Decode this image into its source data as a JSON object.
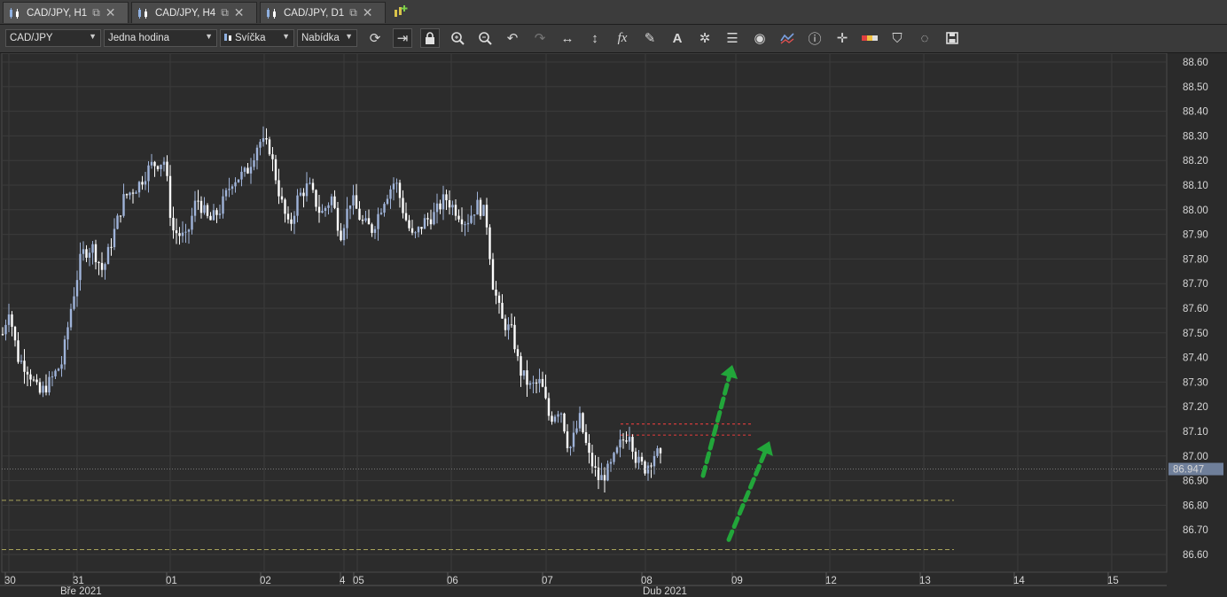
{
  "tabs": [
    {
      "label": "CAD/JPY, H1",
      "active": true
    },
    {
      "label": "CAD/JPY, H4",
      "active": false
    },
    {
      "label": "CAD/JPY, D1",
      "active": false
    }
  ],
  "toolbar": {
    "instrument": "CAD/JPY",
    "timeframe": "Jedna hodina",
    "chart_type": "Svíčka",
    "price_side": "Nabídka",
    "icons": [
      "refresh-icon",
      "shift-chart-icon",
      "lock-icon",
      "zoom-in-icon",
      "zoom-out-icon",
      "undo-icon",
      "redo-icon",
      "horizontal-resize-icon",
      "vertical-resize-icon",
      "indicator-fx-icon",
      "pencil-icon",
      "text-tool-icon",
      "crosshair-star-icon",
      "layers-icon",
      "eye-icon",
      "chart-pattern-icon",
      "info-icon",
      "cursor-cross-icon",
      "ruler-icon",
      "paint-bucket-icon",
      "cycle-icon",
      "save-icon"
    ]
  },
  "colors": {
    "background": "#2a2a2a",
    "bull": "#9fb3d9",
    "bear": "#ffffff",
    "grid": "#3b3b3b",
    "price_tag": "#6f7f9a",
    "red_lines": "#d23b3b",
    "yellow_lines": "#a8a35a",
    "arrows": "#22a63a"
  },
  "chart_data": {
    "type": "candlestick",
    "instrument": "CAD/JPY",
    "timeframe": "H1",
    "ylim": [
      86.55,
      88.65
    ],
    "y_ticks": [
      "88.60",
      "88.50",
      "88.40",
      "88.30",
      "88.20",
      "88.10",
      "88.00",
      "87.90",
      "87.80",
      "87.70",
      "87.60",
      "87.50",
      "87.40",
      "87.30",
      "87.20",
      "87.10",
      "87.00",
      "86.90",
      "86.80",
      "86.70",
      "86.60"
    ],
    "x_ticks": [
      "30",
      "31",
      "01",
      "02",
      "4",
      "05",
      "06",
      "07",
      "08",
      "09",
      "12",
      "13",
      "14",
      "15"
    ],
    "x_month_labels": [
      "Bře 2021",
      "Dub 2021"
    ],
    "current_price": "86.947",
    "horizontal_levels": {
      "red_dotted": [
        87.13,
        87.085
      ],
      "yellow_dashed": [
        86.82,
        86.62
      ]
    },
    "close_path": [
      [
        0,
        87.45
      ],
      [
        10,
        87.6
      ],
      [
        20,
        87.4
      ],
      [
        32,
        87.35
      ],
      [
        44,
        87.25
      ],
      [
        56,
        87.3
      ],
      [
        70,
        87.38
      ],
      [
        80,
        87.6
      ],
      [
        92,
        87.82
      ],
      [
        104,
        87.85
      ],
      [
        116,
        87.75
      ],
      [
        128,
        87.9
      ],
      [
        140,
        88.05
      ],
      [
        156,
        88.1
      ],
      [
        170,
        88.18
      ],
      [
        186,
        88.2
      ],
      [
        194,
        87.92
      ],
      [
        210,
        87.88
      ],
      [
        222,
        88.05
      ],
      [
        236,
        87.95
      ],
      [
        248,
        88.0
      ],
      [
        262,
        88.12
      ],
      [
        278,
        88.15
      ],
      [
        292,
        88.28
      ],
      [
        304,
        88.25
      ],
      [
        316,
        88.05
      ],
      [
        326,
        87.92
      ],
      [
        336,
        88.05
      ],
      [
        348,
        88.1
      ],
      [
        362,
        87.98
      ],
      [
        374,
        88.05
      ],
      [
        384,
        87.9
      ],
      [
        396,
        88.05
      ],
      [
        408,
        87.95
      ],
      [
        420,
        87.92
      ],
      [
        434,
        88.05
      ],
      [
        446,
        88.12
      ],
      [
        456,
        87.98
      ],
      [
        466,
        87.88
      ],
      [
        478,
        87.95
      ],
      [
        490,
        87.98
      ],
      [
        502,
        88.05
      ],
      [
        514,
        88.0
      ],
      [
        526,
        87.95
      ],
      [
        538,
        88.02
      ],
      [
        548,
        87.98
      ],
      [
        556,
        87.7
      ],
      [
        566,
        87.55
      ],
      [
        578,
        87.5
      ],
      [
        586,
        87.35
      ],
      [
        598,
        87.28
      ],
      [
        610,
        87.3
      ],
      [
        620,
        87.15
      ],
      [
        632,
        87.2
      ],
      [
        642,
        87.02
      ],
      [
        654,
        87.15
      ],
      [
        664,
        87.0
      ],
      [
        676,
        86.9
      ],
      [
        688,
        86.95
      ],
      [
        700,
        87.05
      ],
      [
        710,
        87.1
      ],
      [
        718,
        86.98
      ],
      [
        728,
        86.95
      ],
      [
        740,
        87.02
      ],
      [
        748,
        86.96
      ]
    ],
    "annotations": [
      {
        "type": "arrow",
        "color": "green",
        "from": [
          793,
          86.92
        ],
        "to": [
          826,
          87.37
        ]
      },
      {
        "type": "arrow",
        "color": "green",
        "from": [
          822,
          86.66
        ],
        "to": [
          868,
          87.06
        ]
      }
    ]
  }
}
